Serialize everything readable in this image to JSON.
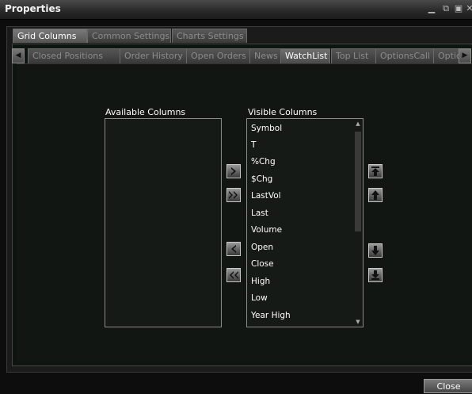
{
  "window": {
    "title": "Properties"
  },
  "top_tabs": [
    {
      "label": "Grid Columns",
      "active": true
    },
    {
      "label": "Common Settings",
      "active": false
    },
    {
      "label": "Charts Settings",
      "active": false
    }
  ],
  "view_tabs": [
    {
      "label": "Closed Positions",
      "active": false
    },
    {
      "label": "Order History",
      "active": false
    },
    {
      "label": "Open Orders",
      "active": false
    },
    {
      "label": "News",
      "active": false
    },
    {
      "label": "WatchList",
      "active": true
    },
    {
      "label": "Top List",
      "active": false
    },
    {
      "label": "OptionsCall",
      "active": false
    },
    {
      "label": "Optic",
      "active": false
    }
  ],
  "available": {
    "label": "Available Columns",
    "items": []
  },
  "visible": {
    "label": "Visible Columns",
    "items": [
      "Symbol",
      "T",
      "%Chg",
      "$Chg",
      "LastVol",
      "Last",
      "Volume",
      "Open",
      "Close",
      "High",
      "Low",
      "Year High"
    ]
  },
  "close_label": "Close",
  "icons": {
    "add": "chevron-right-icon",
    "add_all": "double-chevron-right-icon",
    "remove": "chevron-left-icon",
    "remove_all": "double-chevron-left-icon",
    "move_top": "arrow-up-to-top-icon",
    "move_up": "arrow-up-icon",
    "move_down": "arrow-down-icon",
    "move_bottom": "arrow-down-to-bottom-icon"
  }
}
